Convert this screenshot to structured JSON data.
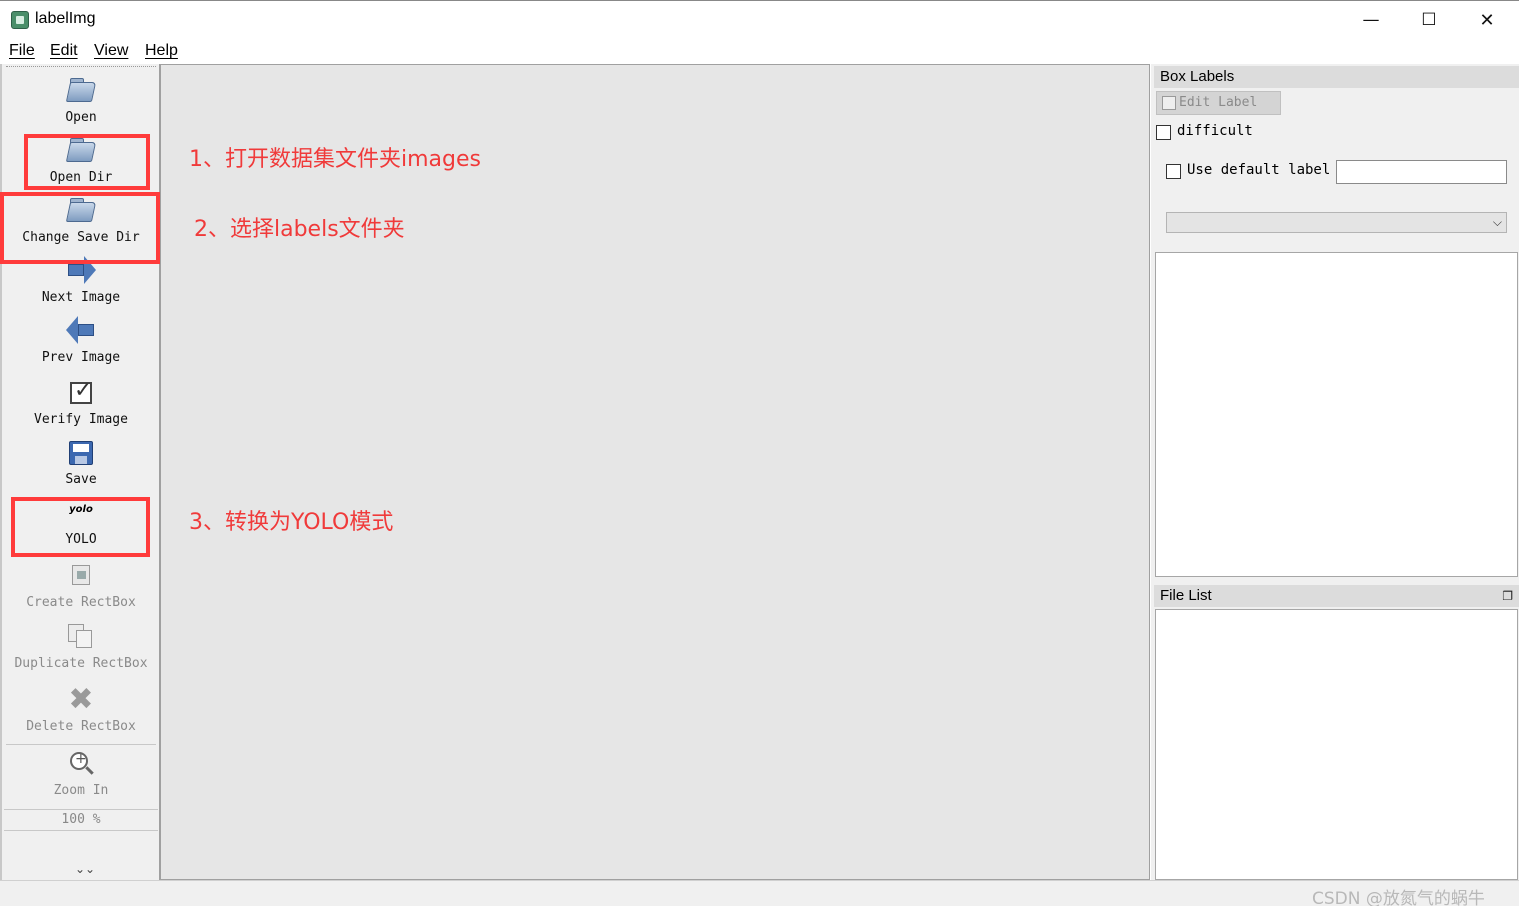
{
  "window": {
    "title": "labelImg",
    "controls": {
      "minimize": "—",
      "maximize": "☐",
      "close": "✕"
    }
  },
  "menu": {
    "items": [
      {
        "label": "File"
      },
      {
        "label": "Edit"
      },
      {
        "label": "View"
      },
      {
        "label": "Help"
      }
    ]
  },
  "toolbar": {
    "tools": [
      {
        "label": "Open",
        "icon": "open-folder-icon",
        "enabled": true
      },
      {
        "label": "Open Dir",
        "icon": "open-dir-icon",
        "enabled": true
      },
      {
        "label": "Change Save Dir",
        "icon": "change-save-dir-icon",
        "enabled": true
      },
      {
        "label": "Next Image",
        "icon": "next-arrow-icon",
        "enabled": true
      },
      {
        "label": "Prev Image",
        "icon": "prev-arrow-icon",
        "enabled": true
      },
      {
        "label": "Verify Image",
        "icon": "verify-check-icon",
        "enabled": true
      },
      {
        "label": "Save",
        "icon": "save-floppy-icon",
        "enabled": true
      },
      {
        "label": "YOLO",
        "icon": "yolo-format-icon",
        "icon_text": "yolo",
        "enabled": true
      },
      {
        "label": "Create RectBox",
        "icon": "create-rectbox-icon",
        "enabled": false
      },
      {
        "label": "Duplicate RectBox",
        "icon": "duplicate-rectbox-icon",
        "enabled": false
      },
      {
        "label": "Delete RectBox",
        "icon": "delete-rectbox-icon",
        "enabled": false
      },
      {
        "label": "Zoom In",
        "icon": "zoom-in-icon",
        "enabled": false
      }
    ],
    "zoom_level": "100 %",
    "expand_glyph": "⌄⌄"
  },
  "annotations": [
    {
      "text": "1、打开数据集文件夹images"
    },
    {
      "text": "2、选择labels文件夹"
    },
    {
      "text": "3、转换为YOLO模式"
    }
  ],
  "box_labels": {
    "title": "Box Labels",
    "edit_label_button": "Edit Label",
    "difficult_label": "difficult",
    "difficult_checked": false,
    "use_default_label": "Use default label",
    "use_default_checked": false,
    "default_label_value": "",
    "combo_value": ""
  },
  "file_list": {
    "title": "File List"
  },
  "statusbar": {
    "text": "",
    "watermark": "CSDN @放氮气的蜗牛"
  },
  "colors": {
    "highlight": "#ff3b3b",
    "annotation_text": "#f03a3a",
    "canvas": "#e6e6e6",
    "panel": "#f0f0f0"
  }
}
